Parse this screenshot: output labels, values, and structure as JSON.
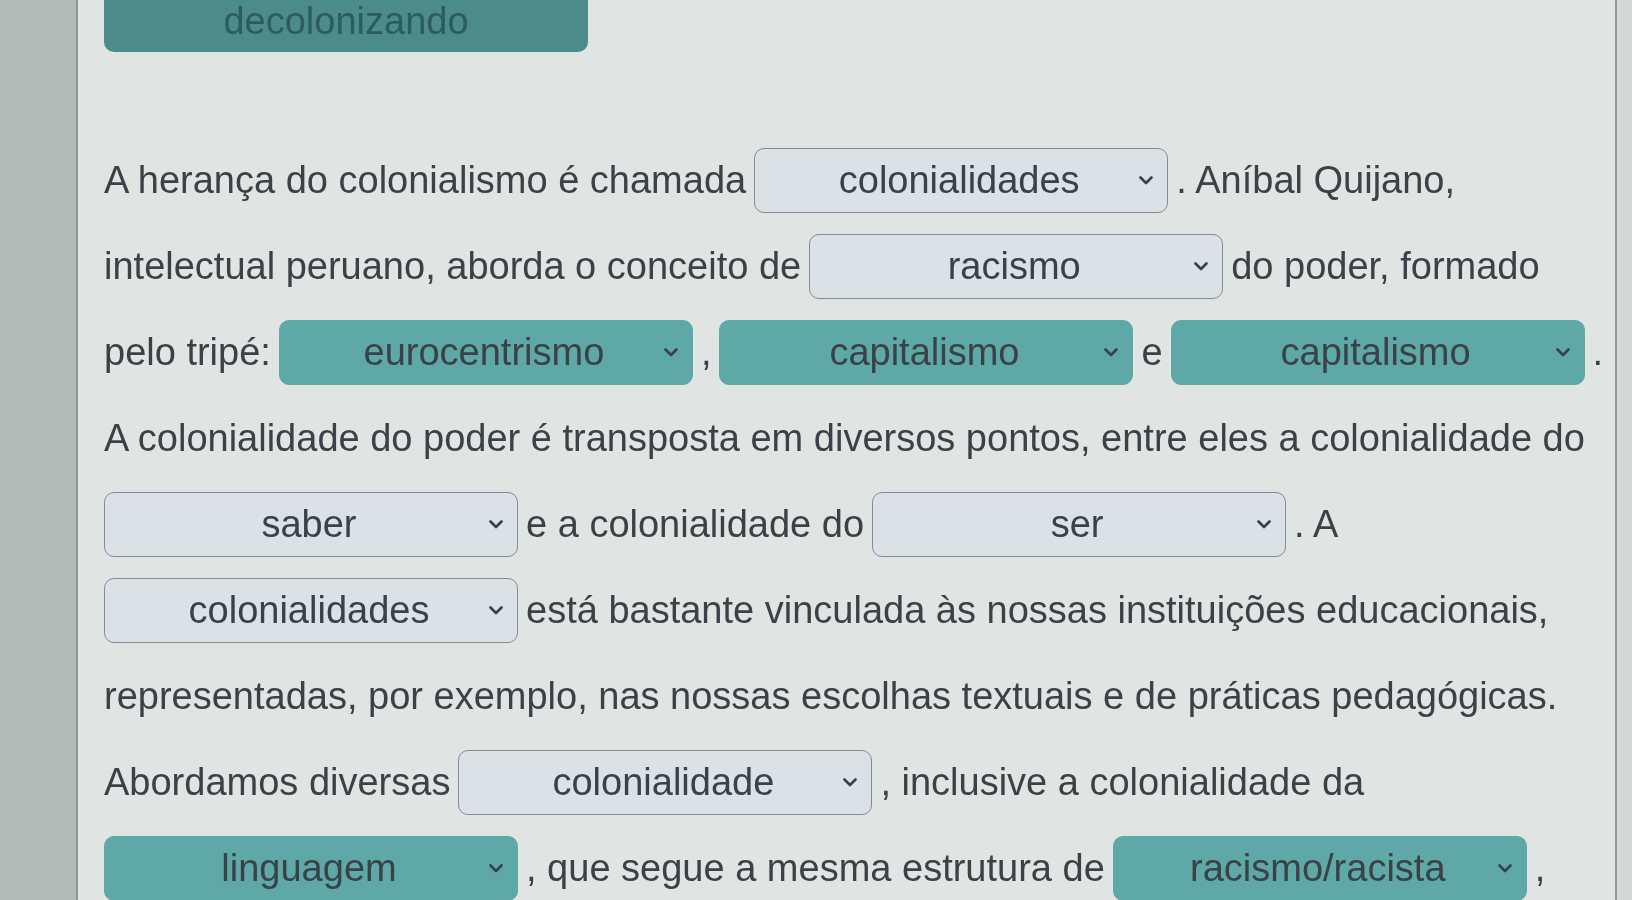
{
  "top_field": {
    "value": "decolonizando",
    "highlighted": true
  },
  "lines": [
    [
      {
        "kind": "text",
        "text": "A herança do colonialismo é chamada"
      },
      {
        "kind": "dropdown",
        "value": "colonialidades",
        "highlighted": false
      },
      {
        "kind": "text",
        "text": ". Aníbal Quijano,"
      }
    ],
    [
      {
        "kind": "text",
        "text": "intelectual peruano, aborda o conceito de"
      },
      {
        "kind": "dropdown",
        "value": "racismo",
        "highlighted": false
      },
      {
        "kind": "text",
        "text": "do poder, formado"
      }
    ],
    [
      {
        "kind": "text",
        "text": "pelo tripé:"
      },
      {
        "kind": "dropdown",
        "value": "eurocentrismo",
        "highlighted": true
      },
      {
        "kind": "text",
        "text": ","
      },
      {
        "kind": "dropdown",
        "value": "capitalismo",
        "highlighted": true
      },
      {
        "kind": "text",
        "text": "e"
      },
      {
        "kind": "dropdown",
        "value": "capitalismo",
        "highlighted": true
      },
      {
        "kind": "text",
        "text": "."
      }
    ],
    [
      {
        "kind": "text",
        "text": "A colonialidade do poder é transposta em diversos pontos, entre eles a colonialidade do"
      }
    ],
    [
      {
        "kind": "dropdown",
        "value": "saber",
        "highlighted": false
      },
      {
        "kind": "text",
        "text": "e a colonialidade do"
      },
      {
        "kind": "dropdown",
        "value": "ser",
        "highlighted": false
      },
      {
        "kind": "text",
        "text": ". A"
      }
    ],
    [
      {
        "kind": "dropdown",
        "value": "colonialidades",
        "highlighted": false
      },
      {
        "kind": "text",
        "text": "está bastante vinculada às nossas instituições educacionais,"
      }
    ],
    [
      {
        "kind": "text",
        "text": "representadas, por exemplo, nas nossas escolhas textuais e de práticas pedagógicas."
      }
    ],
    [
      {
        "kind": "text",
        "text": "Abordamos diversas"
      },
      {
        "kind": "dropdown",
        "value": "colonialidade",
        "highlighted": false
      },
      {
        "kind": "text",
        "text": ", inclusive a colonialidade da"
      }
    ],
    [
      {
        "kind": "dropdown",
        "value": "linguagem",
        "highlighted": true
      },
      {
        "kind": "text",
        "text": ", que segue a mesma estrutura de"
      },
      {
        "kind": "dropdown",
        "value": "racismo/racista",
        "highlighted": true
      },
      {
        "kind": "text",
        "text": ","
      }
    ]
  ]
}
